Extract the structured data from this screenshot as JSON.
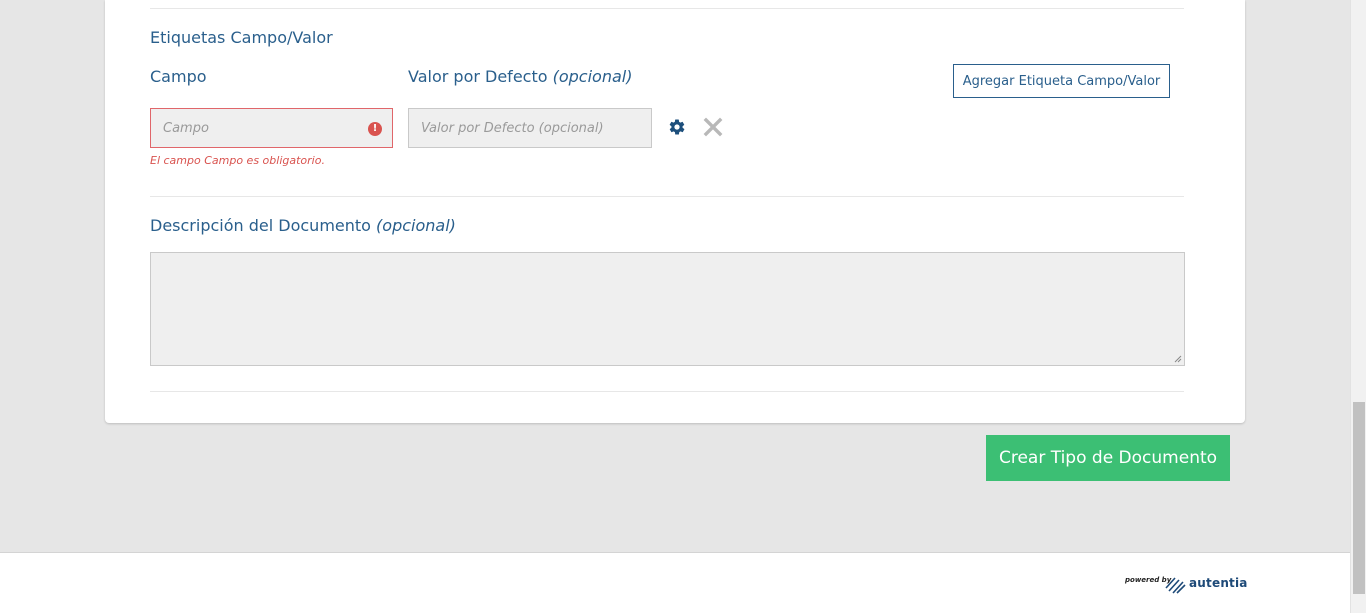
{
  "section": {
    "title": "Etiquetas Campo/Valor",
    "field_label": "Campo",
    "default_label": "Valor por Defecto",
    "default_optional": "(opcional)",
    "add_button": "Agregar Etiqueta Campo/Valor"
  },
  "inputs": {
    "field_placeholder": "Campo",
    "field_value": "",
    "default_placeholder": "Valor por Defecto (opcional)",
    "default_value": "",
    "error_icon_glyph": "!",
    "error_message": "El campo Campo es obligatorio."
  },
  "row_icons": {
    "settings": "gear-icon",
    "remove": "close-icon"
  },
  "description": {
    "label": "Descripción del Documento",
    "optional": "(opcional)",
    "value": ""
  },
  "submit": {
    "label": "Crear Tipo de Documento"
  },
  "footer": {
    "powered_by": "powered by",
    "brand": "autentia"
  },
  "colors": {
    "accent_blue": "#2a5f8c",
    "error_red": "#d9534f",
    "submit_green": "#3cbf74"
  }
}
